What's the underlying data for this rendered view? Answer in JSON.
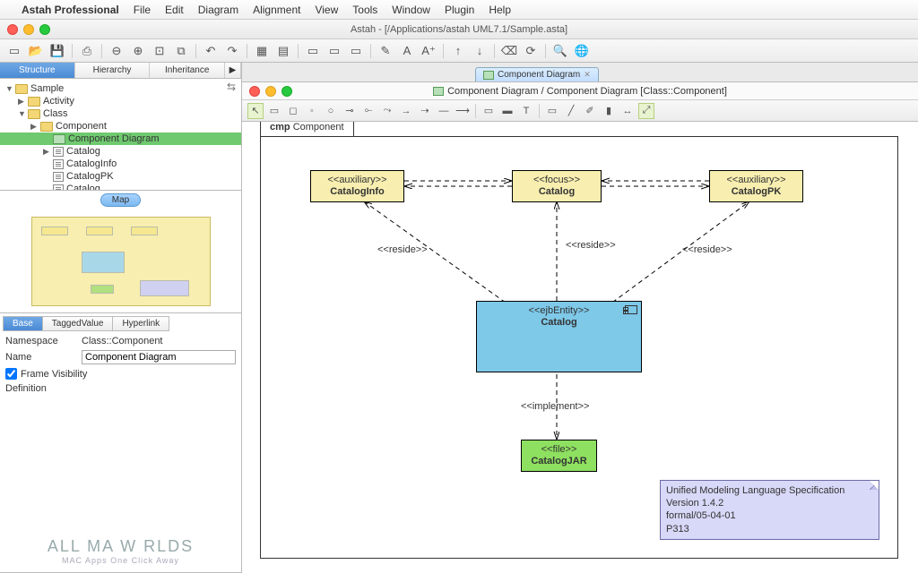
{
  "menubar": {
    "apple": "",
    "appname": "Astah Professional",
    "items": [
      "File",
      "Edit",
      "Diagram",
      "Alignment",
      "View",
      "Tools",
      "Window",
      "Plugin",
      "Help"
    ]
  },
  "window": {
    "title": "Astah - [/Applications/astah UML7.1/Sample.asta]"
  },
  "sidebar": {
    "tabs": {
      "structure": "Structure",
      "hierarchy": "Hierarchy",
      "inheritance": "Inheritance",
      "more": "▶"
    },
    "tree": {
      "root": "Sample",
      "n1": "Activity",
      "n2": "Class",
      "n3": "Component",
      "n4": "Component Diagram",
      "n5": "Catalog",
      "n6": "CatalogInfo",
      "n7": "CatalogPK",
      "n8": "Catalog"
    },
    "map": {
      "label": "Map"
    },
    "props": {
      "tabs": {
        "base": "Base",
        "tagged": "TaggedValue",
        "hyperlink": "Hyperlink"
      },
      "namespace_lbl": "Namespace",
      "namespace_val": "Class::Component",
      "name_lbl": "Name",
      "name_val": "Component Diagram",
      "framevis_lbl": "Frame Visibility",
      "definition_lbl": "Definition"
    },
    "watermark": {
      "main": "ALL MA  W RLDS",
      "sub": "MAC Apps One Click Away"
    }
  },
  "diagram": {
    "tab": "Component Diagram",
    "title": "Component Diagram / Component Diagram [Class::Component]",
    "frame": {
      "prefix": "cmp",
      "name": "Component"
    },
    "nodes": {
      "cinfo": {
        "stereo": "<<auxiliary>>",
        "name": "CatalogInfo"
      },
      "catalog": {
        "stereo": "<<focus>>",
        "name": "Catalog"
      },
      "cpk": {
        "stereo": "<<auxiliary>>",
        "name": "CatalogPK"
      },
      "entity": {
        "stereo": "<<ejbEntity>>",
        "name": "Catalog"
      },
      "jar": {
        "stereo": "<<file>>",
        "name": "CatalogJAR"
      }
    },
    "labels": {
      "reside1": "<<reside>>",
      "reside2": "<<reside>>",
      "reside3": "<<reside>>",
      "implement": "<<implement>>"
    },
    "note": {
      "l1": "Unified Modeling Language Specification",
      "l2": "Version 1.4.2",
      "l3": "formal/05-04-01",
      "l4": "P313"
    }
  }
}
